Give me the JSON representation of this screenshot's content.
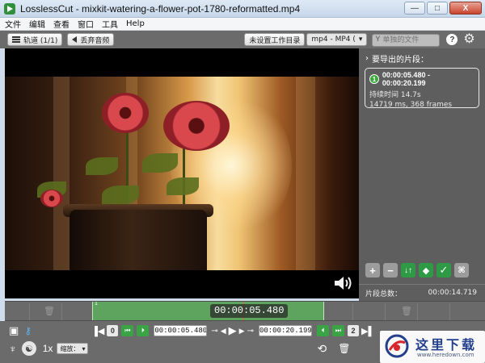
{
  "window": {
    "title": "LosslessCut - mixkit-watering-a-flower-pot-1780-reformatted.mp4",
    "controls": {
      "minimize": "—",
      "maximize": "□",
      "close": "X"
    }
  },
  "menu": {
    "items": [
      "文件",
      "编辑",
      "查看",
      "窗口",
      "工具",
      "Help"
    ]
  },
  "toolbar": {
    "tracks_label": "轨道 (1/1)",
    "discard_audio_label": "丢弃音频",
    "working_dir_label": "未设置工作目录",
    "format_label": "mp4 - MP4 (",
    "search_placeholder": "单独的文件",
    "help_label": "?"
  },
  "side_panel": {
    "title": "要导出的片段：",
    "segment": {
      "index": "1",
      "range": "00:00:05.480 - 00:00:20.199",
      "duration_label": "持续时间 14.7s",
      "frames_label": "14719 ms, 368 frames"
    },
    "footer_label": "片段总数：",
    "footer_total": "00:00:14.719"
  },
  "timeline": {
    "current_time": "00:00:05.480",
    "segment_label": "1"
  },
  "controls": {
    "segment_start_num": "0",
    "start_time": "00:00:05.480",
    "end_time": "00:00:20.199",
    "segment_end_num": "2",
    "speed_label": "1x",
    "zoom_label": "缩放："
  },
  "watermark": {
    "title": "这里下载",
    "url": "www.heredown.com"
  },
  "colors": {
    "accent_green": "#3aa345",
    "segment_green": "#5ea35e",
    "panel_grey": "#5e5e5e"
  },
  "icons": [
    "hamburger-icon",
    "speaker-icon",
    "search-icon",
    "help-icon",
    "gear-icon",
    "volume-icon",
    "trash-icon",
    "play-icon",
    "key-icon",
    "rotate-icon",
    "camera-icon"
  ]
}
